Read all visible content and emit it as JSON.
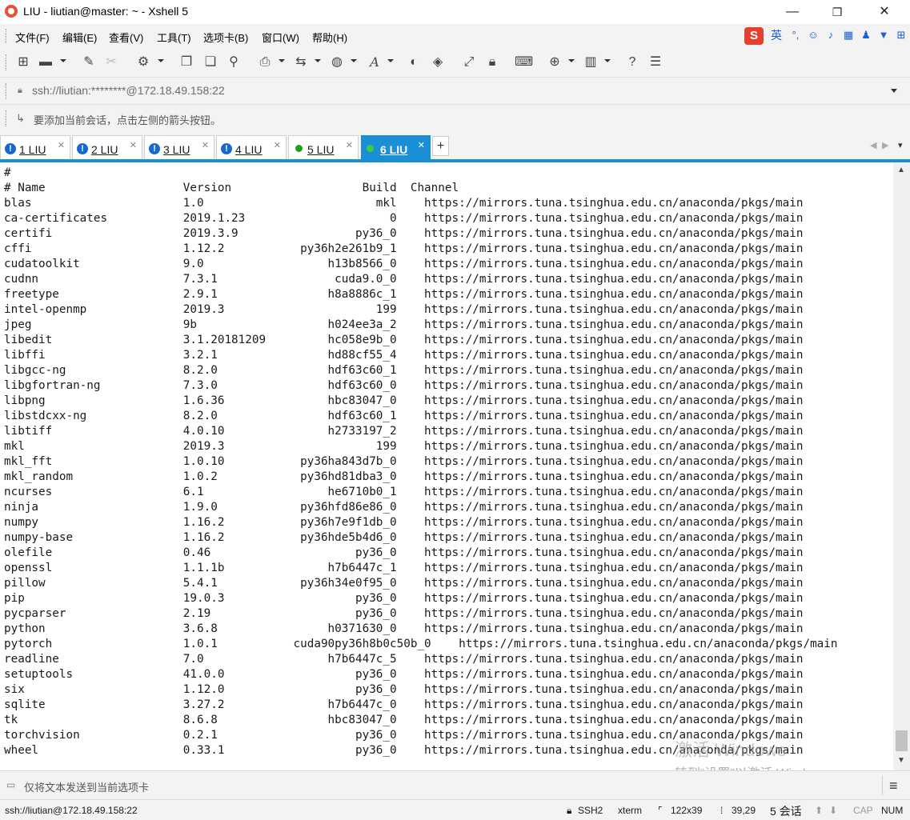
{
  "window": {
    "title": "LIU - liutian@master: ~ - Xshell 5",
    "minimize_glyph": "—",
    "maximize_glyph": "❐",
    "close_glyph": "✕"
  },
  "menu": {
    "items": [
      "文件(F)",
      "编辑(E)",
      "查看(V)",
      "工具(T)",
      "选项卡(B)",
      "窗口(W)",
      "帮助(H)"
    ]
  },
  "ime": {
    "logo": "S",
    "mode": "英",
    "icons": [
      "punct-icon",
      "emoji-icon",
      "mic-icon",
      "keyboard-icon",
      "user-icon",
      "shirt-icon",
      "grid-icon"
    ]
  },
  "address": {
    "value": "ssh://liutian:********@172.18.49.158:22"
  },
  "hint": {
    "text": "要添加当前会话，点击左侧的箭头按钮。"
  },
  "tabs": [
    {
      "label": "1 LIU",
      "status": "alert"
    },
    {
      "label": "2 LIU",
      "status": "alert"
    },
    {
      "label": "3 LIU",
      "status": "alert"
    },
    {
      "label": "4 LIU",
      "status": "alert"
    },
    {
      "label": "5 LIU",
      "status": "connected"
    },
    {
      "label": "6 LIU",
      "status": "connected",
      "active": true
    }
  ],
  "tab_add_label": "+",
  "terminal": {
    "lines": [
      "#",
      "# Name                    Version                   Build  Channel",
      "blas                      1.0                         mkl    https://mirrors.tuna.tsinghua.edu.cn/anaconda/pkgs/main",
      "ca-certificates           2019.1.23                     0    https://mirrors.tuna.tsinghua.edu.cn/anaconda/pkgs/main",
      "certifi                   2019.3.9                 py36_0    https://mirrors.tuna.tsinghua.edu.cn/anaconda/pkgs/main",
      "cffi                      1.12.2           py36h2e261b9_1    https://mirrors.tuna.tsinghua.edu.cn/anaconda/pkgs/main",
      "cudatoolkit               9.0                  h13b8566_0    https://mirrors.tuna.tsinghua.edu.cn/anaconda/pkgs/main",
      "cudnn                     7.3.1                 cuda9.0_0    https://mirrors.tuna.tsinghua.edu.cn/anaconda/pkgs/main",
      "freetype                  2.9.1                h8a8886c_1    https://mirrors.tuna.tsinghua.edu.cn/anaconda/pkgs/main",
      "intel-openmp              2019.3                      199    https://mirrors.tuna.tsinghua.edu.cn/anaconda/pkgs/main",
      "jpeg                      9b                   h024ee3a_2    https://mirrors.tuna.tsinghua.edu.cn/anaconda/pkgs/main",
      "libedit                   3.1.20181209         hc058e9b_0    https://mirrors.tuna.tsinghua.edu.cn/anaconda/pkgs/main",
      "libffi                    3.2.1                hd88cf55_4    https://mirrors.tuna.tsinghua.edu.cn/anaconda/pkgs/main",
      "libgcc-ng                 8.2.0                hdf63c60_1    https://mirrors.tuna.tsinghua.edu.cn/anaconda/pkgs/main",
      "libgfortran-ng            7.3.0                hdf63c60_0    https://mirrors.tuna.tsinghua.edu.cn/anaconda/pkgs/main",
      "libpng                    1.6.36               hbc83047_0    https://mirrors.tuna.tsinghua.edu.cn/anaconda/pkgs/main",
      "libstdcxx-ng              8.2.0                hdf63c60_1    https://mirrors.tuna.tsinghua.edu.cn/anaconda/pkgs/main",
      "libtiff                   4.0.10               h2733197_2    https://mirrors.tuna.tsinghua.edu.cn/anaconda/pkgs/main",
      "mkl                       2019.3                      199    https://mirrors.tuna.tsinghua.edu.cn/anaconda/pkgs/main",
      "mkl_fft                   1.0.10           py36ha843d7b_0    https://mirrors.tuna.tsinghua.edu.cn/anaconda/pkgs/main",
      "mkl_random                1.0.2            py36hd81dba3_0    https://mirrors.tuna.tsinghua.edu.cn/anaconda/pkgs/main",
      "ncurses                   6.1                  he6710b0_1    https://mirrors.tuna.tsinghua.edu.cn/anaconda/pkgs/main",
      "ninja                     1.9.0            py36hfd86e86_0    https://mirrors.tuna.tsinghua.edu.cn/anaconda/pkgs/main",
      "numpy                     1.16.2           py36h7e9f1db_0    https://mirrors.tuna.tsinghua.edu.cn/anaconda/pkgs/main",
      "numpy-base                1.16.2           py36hde5b4d6_0    https://mirrors.tuna.tsinghua.edu.cn/anaconda/pkgs/main",
      "olefile                   0.46                     py36_0    https://mirrors.tuna.tsinghua.edu.cn/anaconda/pkgs/main",
      "openssl                   1.1.1b               h7b6447c_1    https://mirrors.tuna.tsinghua.edu.cn/anaconda/pkgs/main",
      "pillow                    5.4.1            py36h34e0f95_0    https://mirrors.tuna.tsinghua.edu.cn/anaconda/pkgs/main",
      "pip                       19.0.3                   py36_0    https://mirrors.tuna.tsinghua.edu.cn/anaconda/pkgs/main",
      "pycparser                 2.19                     py36_0    https://mirrors.tuna.tsinghua.edu.cn/anaconda/pkgs/main",
      "python                    3.6.8                h0371630_0    https://mirrors.tuna.tsinghua.edu.cn/anaconda/pkgs/main",
      "pytorch                   1.0.1           cuda90py36h8b0c50b_0    https://mirrors.tuna.tsinghua.edu.cn/anaconda/pkgs/main",
      "readline                  7.0                  h7b6447c_5    https://mirrors.tuna.tsinghua.edu.cn/anaconda/pkgs/main",
      "setuptools                41.0.0                   py36_0    https://mirrors.tuna.tsinghua.edu.cn/anaconda/pkgs/main",
      "six                       1.12.0                   py36_0    https://mirrors.tuna.tsinghua.edu.cn/anaconda/pkgs/main",
      "sqlite                    3.27.2               h7b6447c_0    https://mirrors.tuna.tsinghua.edu.cn/anaconda/pkgs/main",
      "tk                        8.6.8                hbc83047_0    https://mirrors.tuna.tsinghua.edu.cn/anaconda/pkgs/main",
      "torchvision               0.2.1                    py36_0    https://mirrors.tuna.tsinghua.edu.cn/anaconda/pkgs/main",
      "wheel                     0.33.1                   py36_0    https://mirrors.tuna.tsinghua.edu.cn/anaconda/pkgs/main"
    ]
  },
  "watermark": {
    "line1": "激活 Windows",
    "line2": "转到“设置”以激活 Windows。"
  },
  "send_bar": {
    "text": "仅将文本发送到当前选项卡"
  },
  "status": {
    "connection": "ssh://liutian@172.18.49.158:22",
    "protocol": "SSH2",
    "terminal_type": "xterm",
    "size": "122x39",
    "cursor": "39,29",
    "sessions": "5 会话",
    "caps": "CAP",
    "num": "NUM"
  },
  "colors": {
    "accent": "#1a8fd6",
    "alert_icon": "#1769d1",
    "connected_dot": "#1aa31a",
    "ime_brand": "#e6402e"
  }
}
